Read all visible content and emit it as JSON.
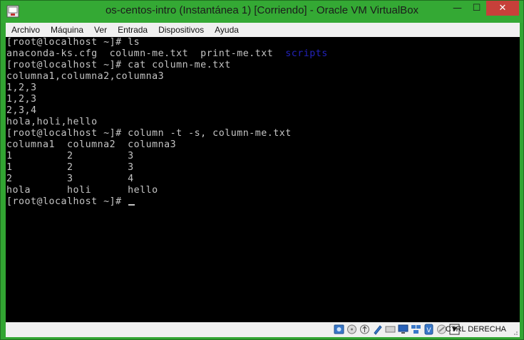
{
  "window": {
    "title": "os-centos-intro (Instantánea 1) [Corriendo] - Oracle VM VirtualBox",
    "minimize_glyph": "—",
    "maximize_glyph": "☐",
    "close_glyph": "✕"
  },
  "menu": [
    {
      "label": "Archivo"
    },
    {
      "label": "Máquina"
    },
    {
      "label": "Ver"
    },
    {
      "label": "Entrada"
    },
    {
      "label": "Dispositivos"
    },
    {
      "label": "Ayuda"
    }
  ],
  "terminal": {
    "lines": [
      {
        "text": "[root@localhost ~]# ls"
      },
      {
        "text": "anaconda-ks.cfg  column-me.txt  print-me.txt  ",
        "dir": "scripts"
      },
      {
        "text": "[root@localhost ~]# cat column-me.txt"
      },
      {
        "text": "columna1,columna2,columna3"
      },
      {
        "text": "1,2,3"
      },
      {
        "text": "1,2,3"
      },
      {
        "text": "2,3,4"
      },
      {
        "text": "hola,holi,hello"
      },
      {
        "text": "[root@localhost ~]# column -t -s, column-me.txt"
      },
      {
        "text": "columna1  columna2  columna3"
      },
      {
        "text": "1         2         3"
      },
      {
        "text": "1         2         3"
      },
      {
        "text": "2         3         4"
      },
      {
        "text": "hola      holi      hello"
      },
      {
        "text": "[root@localhost ~]# "
      }
    ],
    "colors": {
      "text": "#c4c4c4",
      "directory": "#2222bb",
      "background": "#000000"
    }
  },
  "status": {
    "host_key": "CTRL DERECHA",
    "icons": [
      "hard-disk-icon",
      "optical-drive-icon",
      "usb-icon",
      "shared-folders-icon",
      "display-icon",
      "network-icon",
      "capture-icon",
      "usb-device-icon",
      "mouse-integration-icon",
      "keyboard-capture-icon"
    ]
  },
  "colors": {
    "window_frame": "#32a532",
    "close_button": "#c7403a"
  }
}
